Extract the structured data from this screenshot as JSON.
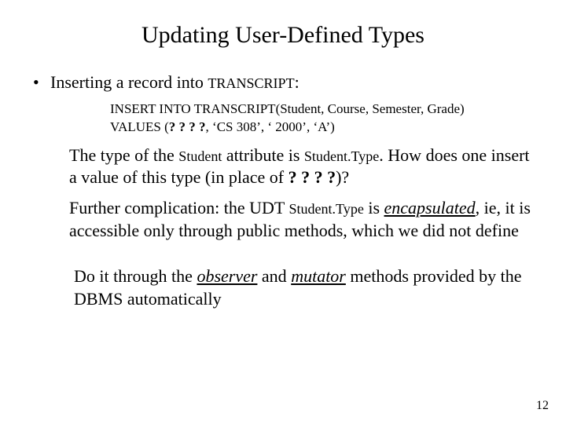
{
  "title": "Updating User-Defined Types",
  "bullet_pre": "Inserting a record into ",
  "bullet_sc": "TRANSCRIPT",
  "bullet_post": ":",
  "code_l1": "INSERT  INTO  TRANSCRIPT(Student, Course, Semester, Grade)",
  "code_l2a": "VALUES  (",
  "code_q1": "? ? ? ?",
  "code_l2b": ", ‘CS 308’,  ‘ 2000’,  ‘A’)",
  "p1_a": "The type of the ",
  "p1_student": "Student",
  "p1_b": " attribute is ",
  "p1_st": "Student.Type",
  "p1_c": ".  How does one insert a value of this type (in place of  ",
  "p1_q": "? ? ? ?",
  "p1_d": ")?",
  "p2_a": "Further complication:  the UDT ",
  "p2_st": "Student.Type",
  "p2_b": " is ",
  "p2_enc": "encapsulated",
  "p2_c": ", ie, it is accessible only through public methods, which we did not define",
  "p3_a": "Do it through the ",
  "p3_obs": "observer",
  "p3_b": " and ",
  "p3_mut": "mutator",
  "p3_c": " methods provided by the DBMS automatically",
  "pagenum": "12"
}
